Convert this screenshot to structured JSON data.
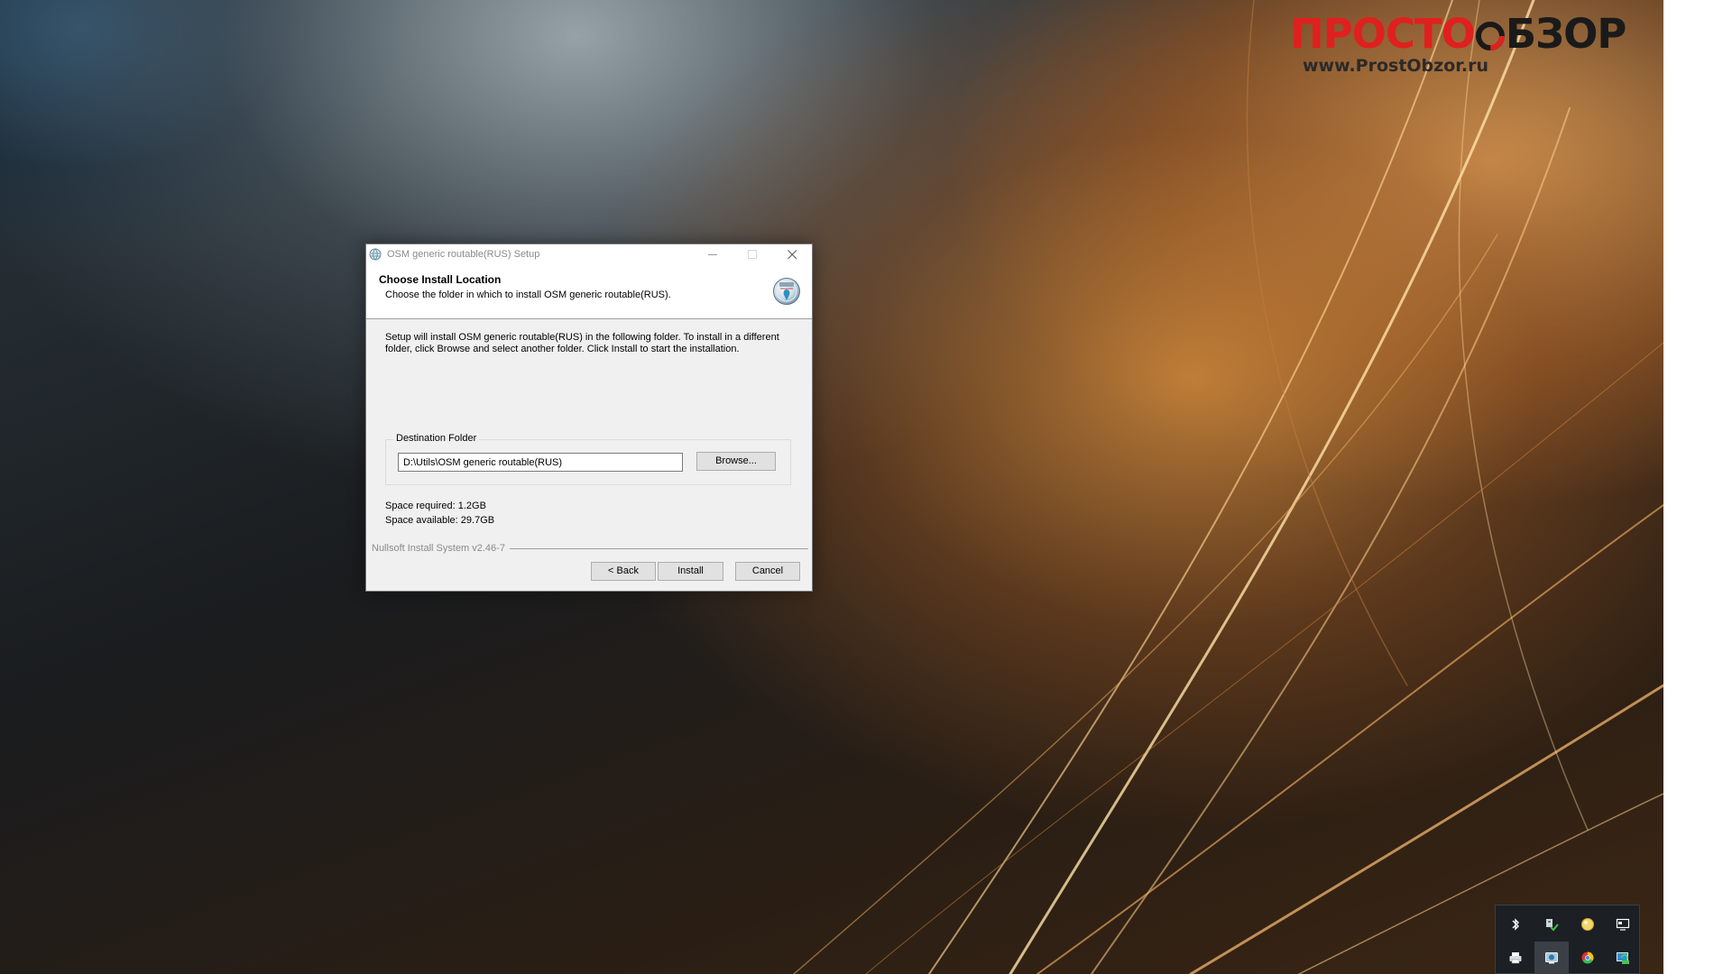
{
  "watermark": {
    "title_red": "ПРОСТО",
    "title_dark": "БЗОР",
    "url": "www.ProstObzor.ru"
  },
  "installer": {
    "window_title": "OSM generic routable(RUS) Setup",
    "header_title": "Choose Install Location",
    "header_subtitle": "Choose the folder in which to install OSM generic routable(RUS).",
    "intro_text": "Setup will install OSM generic routable(RUS) in the following folder. To install in a different folder, click Browse and select another folder. Click Install to start the installation.",
    "destination_label": "Destination Folder",
    "destination_path": "D:\\Utils\\OSM generic routable(RUS)",
    "browse_label": "Browse...",
    "space_required": "Space required: 1.2GB",
    "space_available": "Space available: 29.7GB",
    "branding": "Nullsoft Install System v2.46-7",
    "back_label": "< Back",
    "install_label": "Install",
    "cancel_label": "Cancel"
  },
  "icons": {
    "title": "nsis-globe-icon",
    "header": "globe-icon",
    "window_controls": [
      "minimize-icon",
      "maximize-icon",
      "close-icon"
    ],
    "tray": [
      "bluetooth-icon",
      "network-icon",
      "status-icon",
      "display-icon",
      "printer-icon",
      "app-icon",
      "chrome-icon",
      "sync-icon"
    ]
  },
  "colors": {
    "brand_red": "#e0201e",
    "dialog_bg": "#f0f0f0",
    "header_bg": "#ffffff",
    "tray_bg": "#1c2024"
  }
}
